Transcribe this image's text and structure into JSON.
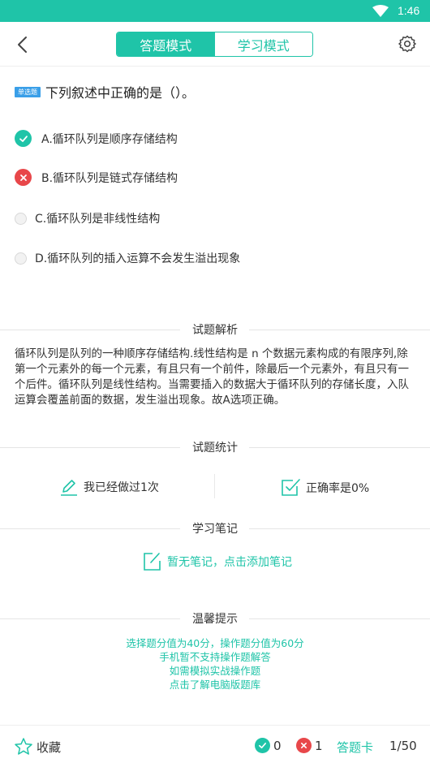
{
  "status": {
    "time": "1:46"
  },
  "header": {
    "tabs": [
      {
        "label": "答题模式",
        "active": true
      },
      {
        "label": "学习模式",
        "active": false
      }
    ]
  },
  "question": {
    "type_badge": "单选题",
    "text": "下列叙述中正确的是（）。",
    "options": [
      {
        "label": "A.循环队列是顺序存储结构",
        "state": "correct"
      },
      {
        "label": "B.循环队列是链式存储结构",
        "state": "wrong"
      },
      {
        "label": "C.循环队列是非线性结构",
        "state": "none"
      },
      {
        "label": "D.循环队列的插入运算不会发生溢出现象",
        "state": "none"
      }
    ]
  },
  "analysis": {
    "title": "试题解析",
    "text": "循环队列是队列的一种顺序存储结构.线性结构是 n 个数据元素构成的有限序列,除第一个元素外的每一个元素，有且只有一个前件，除最后一个元素外，有且只有一个后件。循环队列是线性结构。当需要插入的数据大于循环队列的存储长度，入队运算会覆盖前面的数据，发生溢出现象。故A选项正确。"
  },
  "stats": {
    "title": "试题统计",
    "done": "我已经做过1次",
    "rate": "正确率是0%"
  },
  "notes": {
    "title": "学习笔记",
    "empty": "暂无笔记，点击添加笔记"
  },
  "tips": {
    "title": "温馨提示",
    "lines": [
      "选择题分值为40分，操作题分值为60分",
      "手机暂不支持操作题解答",
      "如需模拟实战操作题",
      "点击了解电脑版题库"
    ]
  },
  "footer": {
    "favorite": "收藏",
    "correct_count": "0",
    "wrong_count": "1",
    "answer_card": "答题卡",
    "pager": "1/50"
  },
  "colors": {
    "accent": "#1fc4a8",
    "wrong": "#e8474a",
    "badge": "#3a9fe8"
  }
}
